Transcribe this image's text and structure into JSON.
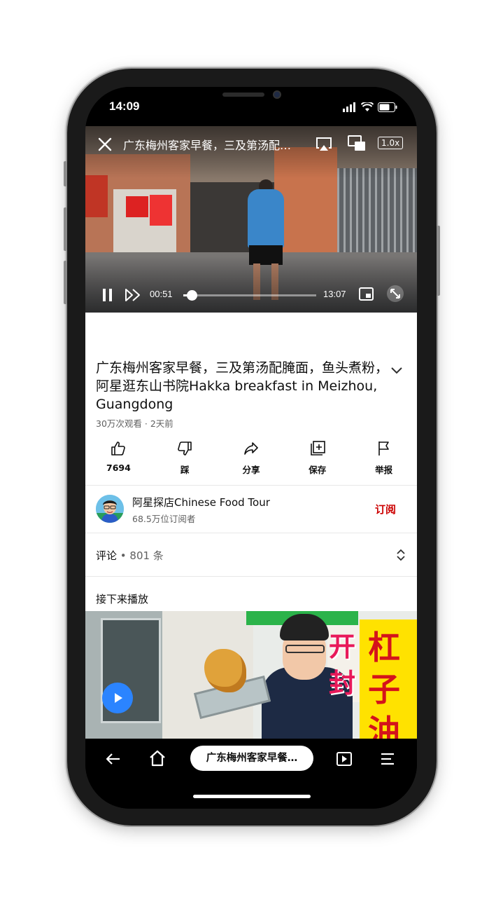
{
  "status": {
    "time": "14:09"
  },
  "player": {
    "title": "广东梅州客家早餐，三及第汤配腌面，鱼头煮粉，阿星逛东山书院Hakka breakfast in Meizhou, Guangdong",
    "speed": "1.0x",
    "current_time": "00:51",
    "duration": "13:07",
    "progress": 0.065
  },
  "video": {
    "heading": "广东梅州客家早餐，三及第汤配腌面，鱼头煮粉，阿星逛东山书院Hakka breakfast in Meizhou, Guangdong",
    "meta": "30万次观看 · 2天前"
  },
  "actions": [
    {
      "icon": "thumbs-up-icon",
      "label": "7694"
    },
    {
      "icon": "thumbs-down-icon",
      "label": "踩"
    },
    {
      "icon": "share-icon",
      "label": "分享"
    },
    {
      "icon": "save-playlist-icon",
      "label": "保存"
    },
    {
      "icon": "flag-icon",
      "label": "举报"
    }
  ],
  "channel": {
    "name": "阿星探店Chinese Food Tour",
    "subscribers": "68.5万位订阅者",
    "subscribe_label": "订阅"
  },
  "comments": {
    "label": "评论",
    "count": " • 801 条"
  },
  "up_next": {
    "label": "接下来播放",
    "thumbnail_text": [
      "开",
      "封",
      "杠",
      "子",
      "油"
    ]
  },
  "bottom_nav": {
    "tab_title": "广东梅州客家早餐…"
  },
  "colors": {
    "accent_red": "#cc0000",
    "play_blue": "#2b84ff"
  }
}
